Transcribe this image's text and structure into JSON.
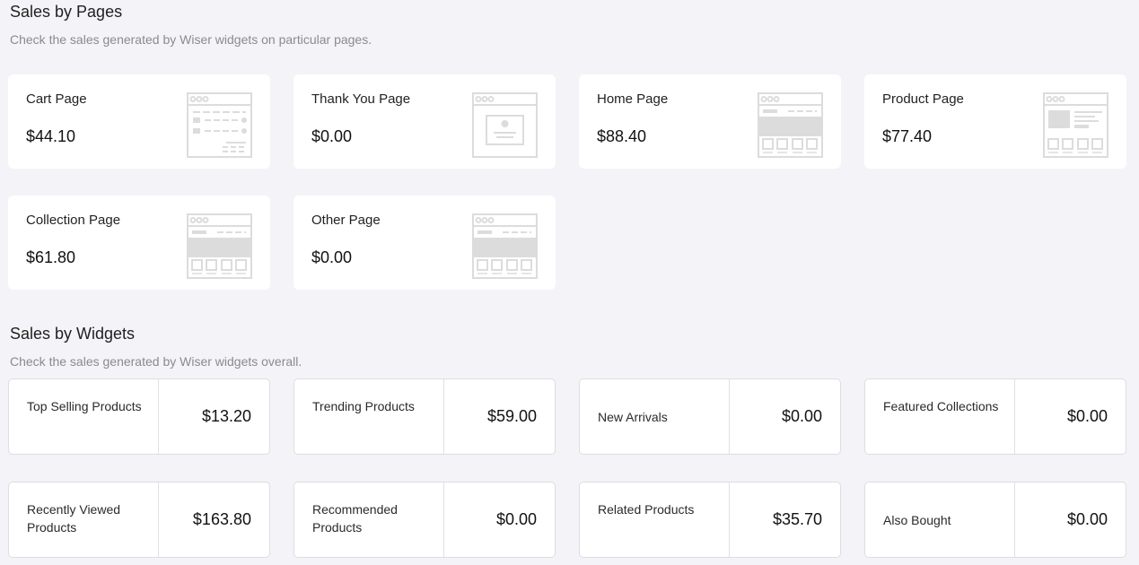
{
  "pages_section": {
    "title": "Sales by Pages",
    "subtitle": "Check the sales generated by Wiser widgets on particular pages.",
    "cards": [
      {
        "label": "Cart Page",
        "value": "$44.10",
        "icon": "cart-page-wireframe-icon"
      },
      {
        "label": "Thank You Page",
        "value": "$0.00",
        "icon": "thank-you-page-wireframe-icon"
      },
      {
        "label": "Home Page",
        "value": "$88.40",
        "icon": "home-page-wireframe-icon"
      },
      {
        "label": "Product Page",
        "value": "$77.40",
        "icon": "product-page-wireframe-icon"
      },
      {
        "label": "Collection Page",
        "value": "$61.80",
        "icon": "collection-page-wireframe-icon"
      },
      {
        "label": "Other Page",
        "value": "$0.00",
        "icon": "other-page-wireframe-icon"
      }
    ]
  },
  "widgets_section": {
    "title": "Sales by Widgets",
    "subtitle": "Check the sales generated by Wiser widgets overall.",
    "cards": [
      {
        "label": "Top Selling Products",
        "value": "$13.20"
      },
      {
        "label": "Trending Products",
        "value": "$59.00"
      },
      {
        "label": "New Arrivals",
        "value": "$0.00"
      },
      {
        "label": "Featured Collections",
        "value": "$0.00"
      },
      {
        "label": "Recently Viewed Products",
        "value": "$163.80"
      },
      {
        "label": "Recommended Products",
        "value": "$0.00"
      },
      {
        "label": "Related Products",
        "value": "$35.70"
      },
      {
        "label": "Also Bought",
        "value": "$0.00"
      }
    ]
  },
  "colors": {
    "background": "#f4f3f8",
    "card": "#ffffff",
    "wireframe": "#dcdcdc"
  }
}
